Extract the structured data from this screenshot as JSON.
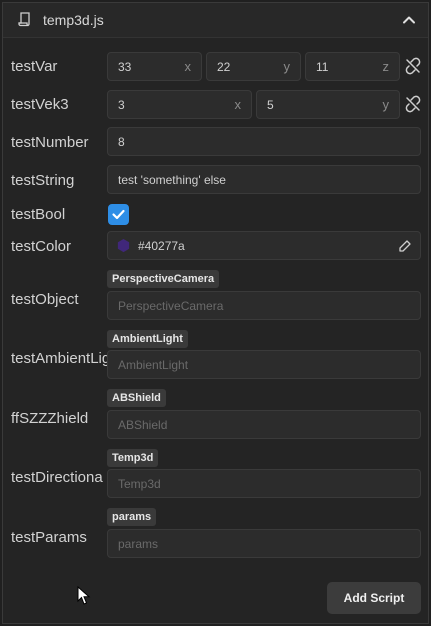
{
  "header": {
    "title": "temp3d.js"
  },
  "rows": {
    "testVar": {
      "label": "testVar",
      "x": "33",
      "y": "22",
      "z": "11"
    },
    "testVek3": {
      "label": "testVek3",
      "x": "3",
      "y": "5"
    },
    "testNumber": {
      "label": "testNumber",
      "value": "8"
    },
    "testString": {
      "label": "testString",
      "value": "test 'something' else"
    },
    "testBool": {
      "label": "testBool",
      "checked": true
    },
    "testColor": {
      "label": "testColor",
      "value": "#40277a"
    },
    "testObject": {
      "label": "testObject",
      "tag": "PerspectiveCamera",
      "placeholder": "PerspectiveCamera"
    },
    "testAmbientLight": {
      "label": "testAmbientLig",
      "tag": "AmbientLight",
      "placeholder": "AmbientLight"
    },
    "ffSZZZhield": {
      "label": "ffSZZZhield",
      "tag": "ABShield",
      "placeholder": "ABShield"
    },
    "testDirectional": {
      "label": "testDirectiona",
      "tag": "Temp3d",
      "placeholder": "Temp3d"
    },
    "testParams": {
      "label": "testParams",
      "tag": "params",
      "placeholder": "params"
    }
  },
  "axes": {
    "x": "x",
    "y": "y",
    "z": "z"
  },
  "add_script_label": "Add Script",
  "colors": {
    "accent": "#2e8ee6",
    "swatch": "#40277a"
  }
}
